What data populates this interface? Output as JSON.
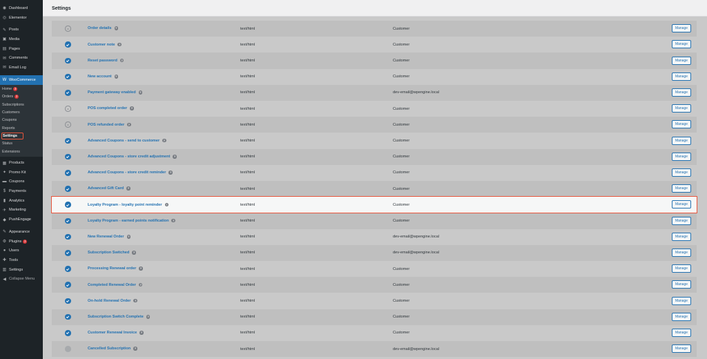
{
  "sidebar": {
    "top_items": [
      {
        "label": "Dashboard",
        "icon": "dashboard-icon",
        "glyph": "◉"
      },
      {
        "label": "Elementor",
        "icon": "elementor-icon",
        "glyph": "◎"
      }
    ],
    "items_a": [
      {
        "label": "Posts",
        "icon": "pin-icon",
        "glyph": "✎"
      },
      {
        "label": "Media",
        "icon": "media-icon",
        "glyph": "▣"
      },
      {
        "label": "Pages",
        "icon": "pages-icon",
        "glyph": "▤"
      },
      {
        "label": "Comments",
        "icon": "comments-icon",
        "glyph": "✉"
      },
      {
        "label": "Email Log",
        "icon": "email-icon",
        "glyph": "✉"
      }
    ],
    "woo": {
      "label": "WooCommerce",
      "icon": "woocommerce-icon",
      "glyph": "W"
    },
    "woo_sub": [
      {
        "label": "Home",
        "badge": "3"
      },
      {
        "label": "Orders",
        "badge": "2"
      },
      {
        "label": "Subscriptions",
        "badge": ""
      },
      {
        "label": "Customers",
        "badge": ""
      },
      {
        "label": "Coupons",
        "badge": ""
      },
      {
        "label": "Reports",
        "badge": ""
      },
      {
        "label": "Settings",
        "badge": ""
      },
      {
        "label": "Status",
        "badge": ""
      },
      {
        "label": "Extensions",
        "badge": ""
      }
    ],
    "items_b": [
      {
        "label": "Products",
        "icon": "products-icon",
        "glyph": "▦"
      },
      {
        "label": "Promo Kit",
        "icon": "promo-icon",
        "glyph": "✦"
      },
      {
        "label": "Coupons",
        "icon": "coupons-icon",
        "glyph": "▬"
      },
      {
        "label": "Payments",
        "icon": "payments-icon",
        "glyph": "$"
      },
      {
        "label": "Analytics",
        "icon": "analytics-icon",
        "glyph": "▮"
      },
      {
        "label": "Marketing",
        "icon": "marketing-icon",
        "glyph": "✈"
      },
      {
        "label": "PushEngage",
        "icon": "pushengage-icon",
        "glyph": "◆"
      }
    ],
    "items_c": [
      {
        "label": "Appearance",
        "icon": "appearance-icon",
        "glyph": "✎"
      },
      {
        "label": "Plugins",
        "icon": "plugins-icon",
        "glyph": "⚙",
        "badge": "2"
      },
      {
        "label": "Users",
        "icon": "users-icon",
        "glyph": "●"
      },
      {
        "label": "Tools",
        "icon": "tools-icon",
        "glyph": "✚"
      },
      {
        "label": "Settings",
        "icon": "settings-icon",
        "glyph": "▥"
      }
    ],
    "collapse": {
      "label": "Collapse Menu",
      "icon": "collapse-icon",
      "glyph": "◀"
    }
  },
  "topbar": {
    "title": "Settings"
  },
  "emails": [
    {
      "name": "Order details",
      "type": "text/html",
      "recipient": "Customer",
      "status": "manual"
    },
    {
      "name": "Customer note",
      "type": "text/html",
      "recipient": "Customer",
      "status": "enabled"
    },
    {
      "name": "Reset password",
      "type": "text/html",
      "recipient": "Customer",
      "status": "enabled"
    },
    {
      "name": "New account",
      "type": "text/html",
      "recipient": "Customer",
      "status": "enabled"
    },
    {
      "name": "Payment gateway enabled",
      "type": "text/html",
      "recipient": "dev-email@wpengine.local",
      "status": "enabled"
    },
    {
      "name": "POS completed order",
      "type": "text/html",
      "recipient": "Customer",
      "status": "manual"
    },
    {
      "name": "POS refunded order",
      "type": "text/html",
      "recipient": "Customer",
      "status": "manual"
    },
    {
      "name": "Advanced Coupons - send to customer",
      "type": "text/html",
      "recipient": "Customer",
      "status": "enabled"
    },
    {
      "name": "Advanced Coupons - store credit adjustment",
      "type": "text/html",
      "recipient": "Customer",
      "status": "enabled"
    },
    {
      "name": "Advanced Coupons - store credit reminder",
      "type": "text/html",
      "recipient": "Customer",
      "status": "enabled"
    },
    {
      "name": "Advanced Gift Card",
      "type": "text/html",
      "recipient": "Customer",
      "status": "enabled"
    },
    {
      "name": "Loyalty Program - loyalty point reminder",
      "type": "text/html",
      "recipient": "Customer",
      "status": "enabled",
      "highlight": true
    },
    {
      "name": "Loyalty Program - earned points notification",
      "type": "text/html",
      "recipient": "Customer",
      "status": "enabled"
    },
    {
      "name": "New Renewal Order",
      "type": "text/html",
      "recipient": "dev-email@wpengine.local",
      "status": "enabled"
    },
    {
      "name": "Subscription Switched",
      "type": "text/html",
      "recipient": "dev-email@wpengine.local",
      "status": "enabled"
    },
    {
      "name": "Processing Renewal order",
      "type": "text/html",
      "recipient": "Customer",
      "status": "enabled"
    },
    {
      "name": "Completed Renewal Order",
      "type": "text/html",
      "recipient": "Customer",
      "status": "enabled"
    },
    {
      "name": "On-hold Renewal Order",
      "type": "text/html",
      "recipient": "Customer",
      "status": "enabled"
    },
    {
      "name": "Subscription Switch Complete",
      "type": "text/html",
      "recipient": "Customer",
      "status": "enabled"
    },
    {
      "name": "Customer Renewal Invoice",
      "type": "text/html",
      "recipient": "Customer",
      "status": "enabled"
    },
    {
      "name": "Cancelled Subscription",
      "type": "text/html",
      "recipient": "dev-email@wpengine.local",
      "status": "disabled"
    }
  ],
  "manage_label": "Manage",
  "help_glyph": "?",
  "colors": {
    "accent": "#2271b1",
    "highlight_outline": "#e8553c",
    "sidebar_bg": "#1d2327",
    "badge": "#d63638"
  }
}
